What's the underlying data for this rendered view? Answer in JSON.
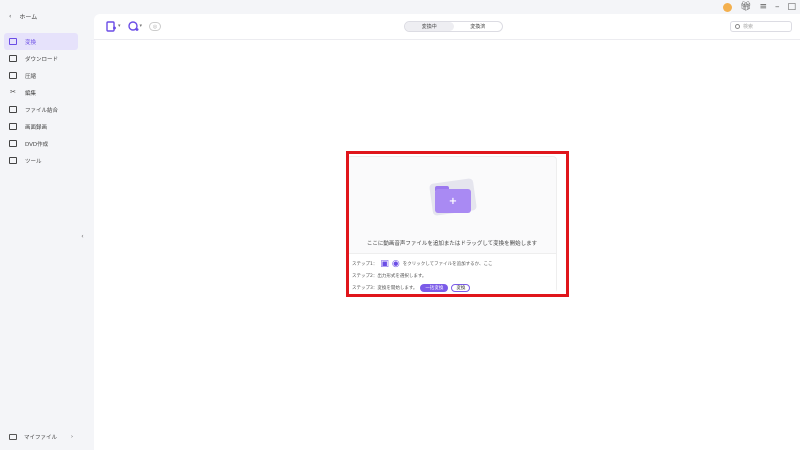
{
  "sidebar": {
    "home": {
      "back": "‹",
      "label": "ホーム"
    },
    "items": [
      {
        "label": "変換",
        "active": true
      },
      {
        "label": "ダウンロード"
      },
      {
        "label": "圧縮"
      },
      {
        "label": "編集"
      },
      {
        "label": "ファイル結合"
      },
      {
        "label": "画面録画"
      },
      {
        "label": "DVD作成"
      },
      {
        "label": "ツール"
      }
    ],
    "my_files": {
      "label": "マイファイル",
      "arrow": "›"
    },
    "collapse": "‹"
  },
  "window": {
    "menu": "≡",
    "minimize": "–",
    "maximize": "□"
  },
  "toolbar": {
    "add_file_icon": "add-file-icon",
    "add_media_icon": "add-media-icon",
    "caret": "▾",
    "tabs": [
      {
        "label": "変換中",
        "active": true
      },
      {
        "label": "変換済"
      }
    ],
    "search_placeholder": "検索"
  },
  "dropzone": {
    "plus": "+",
    "text": "ここに動画音声ファイルを追加またはドラッグして変換を開始します",
    "steps": {
      "step1_prefix": "ステップ1：",
      "step1_suffix": "をクリックしてファイルを追加するか、ここ",
      "step2": "ステップ2：出力形式を選択します。",
      "step3_prefix": "ステップ3：変換を開始します。",
      "convert_all": "一括変換",
      "convert": "変換"
    }
  },
  "colors": {
    "accent": "#6b4de6",
    "highlight": "#e0151b",
    "folder": "#a98af3"
  }
}
